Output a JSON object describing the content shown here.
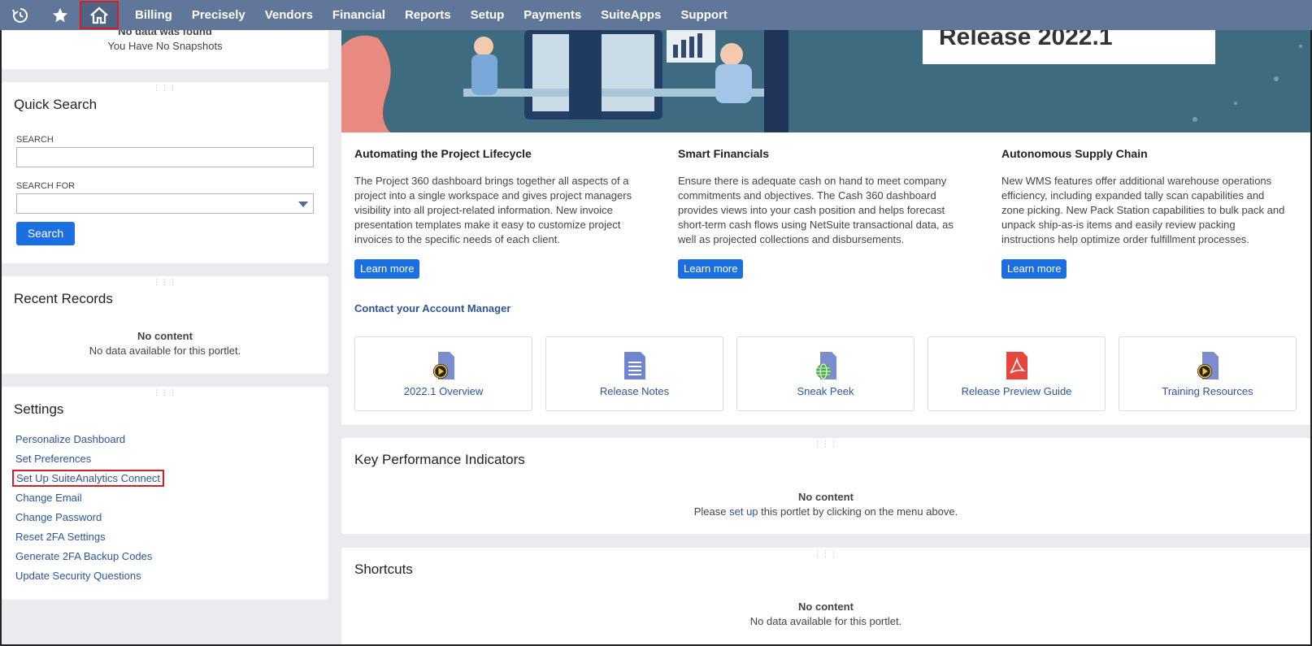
{
  "nav": {
    "items": [
      "Billing",
      "Precisely",
      "Vendors",
      "Financial",
      "Reports",
      "Setup",
      "Payments",
      "SuiteApps",
      "Support"
    ]
  },
  "snapshots": {
    "partial_text": "No data was found",
    "text": "You Have No Snapshots"
  },
  "quick_search": {
    "title": "Quick Search",
    "search_label": "SEARCH",
    "search_value": "",
    "search_for_label": "SEARCH FOR",
    "search_for_value": "",
    "button": "Search"
  },
  "recent_records": {
    "title": "Recent Records",
    "no_content": "No content",
    "message": "No data available for this portlet."
  },
  "settings": {
    "title": "Settings",
    "links": [
      "Personalize Dashboard",
      "Set Preferences",
      "Set Up SuiteAnalytics Connect",
      "Change Email",
      "Change Password",
      "Reset 2FA Settings",
      "Generate 2FA Backup Codes",
      "Update Security Questions"
    ]
  },
  "hero": {
    "release_text": "Release 2022.1"
  },
  "features": [
    {
      "title": "Automating the Project Lifecycle",
      "lines": [
        "The Project 360 dashboard brings together all aspects of a",
        "project into a single workspace and gives project managers",
        "visibility into all project-related information. New invoice",
        "presentation templates make it easy to customize project",
        "invoices to the specific needs of each client."
      ],
      "button": "Learn more"
    },
    {
      "title": "Smart Financials",
      "lines": [
        "Ensure there is adequate cash on hand to meet company",
        "commitments and objectives. The Cash 360 dashboard",
        "provides views into your cash position and helps forecast",
        "short-term cash flows using NetSuite transactional data, as",
        "well as projected collections and disbursements."
      ],
      "button": "Learn more"
    },
    {
      "title": "Autonomous Supply Chain",
      "lines": [
        "New WMS features offer additional warehouse operations",
        "efficiency, including expanded tally scan capabilities and",
        "zone picking. New Pack Station capabilities to bulk pack and",
        "unpack ship-as-is items and easily review packing",
        "instructions help optimize order fulfillment processes."
      ],
      "button": "Learn more"
    }
  ],
  "contact_link": "Contact your Account Manager",
  "resources": [
    {
      "label": "2022.1 Overview",
      "icon": "video-doc-icon"
    },
    {
      "label": "Release Notes",
      "icon": "document-icon"
    },
    {
      "label": "Sneak Peek",
      "icon": "globe-doc-icon"
    },
    {
      "label": "Release Preview Guide",
      "icon": "pdf-icon"
    },
    {
      "label": "Training Resources",
      "icon": "video-doc-icon"
    }
  ],
  "kpi": {
    "title": "Key Performance Indicators",
    "no_content": "No content",
    "message_pre": "Please ",
    "message_link": "set up",
    "message_post": " this portlet by clicking on the menu above."
  },
  "shortcuts": {
    "title": "Shortcuts",
    "no_content": "No content",
    "message": "No data available for this portlet."
  },
  "colors": {
    "nav_bg": "#607799",
    "accent_blue": "#1b6fe0",
    "link": "#2d5597",
    "highlight": "#d0202a"
  }
}
